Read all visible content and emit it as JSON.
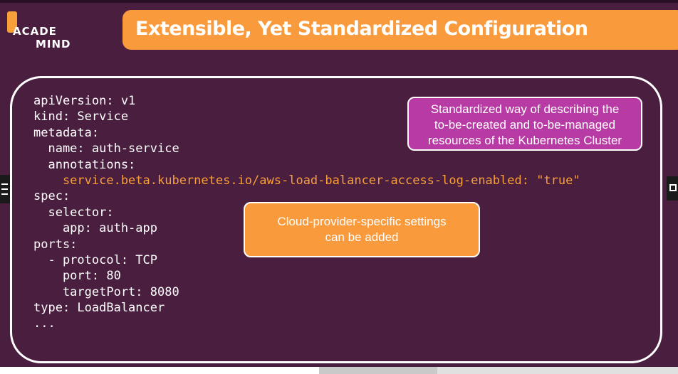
{
  "brand": {
    "line1": "ACADE",
    "line2": "MIND"
  },
  "title": "Extensible, Yet Standardized Configuration",
  "code_lines": [
    "apiVersion: v1",
    "kind: Service",
    "metadata:",
    "  name: auth-service",
    "  annotations:",
    "    service.beta.kubernetes.io/aws-load-balancer-access-log-enabled: \"true\"",
    "spec:",
    "  selector:",
    "    app: auth-app",
    "ports:",
    "  - protocol: TCP",
    "    port: 80",
    "    targetPort: 8080",
    "type: LoadBalancer",
    "..."
  ],
  "callouts": {
    "standardized": [
      "Standardized way of describing the",
      "to-be-created and to-be-managed",
      "resources of the Kubernetes Cluster"
    ],
    "cloud": [
      "Cloud-provider-specific settings",
      "can be added"
    ]
  },
  "colors": {
    "background": "#4a1e3e",
    "accent_orange": "#f99a3c",
    "annotation_orange": "#f7a03a",
    "callout_magenta": "#b83aa4"
  },
  "icons": {
    "left_edge": "menu-icon",
    "right_edge": "fullscreen-icon"
  }
}
